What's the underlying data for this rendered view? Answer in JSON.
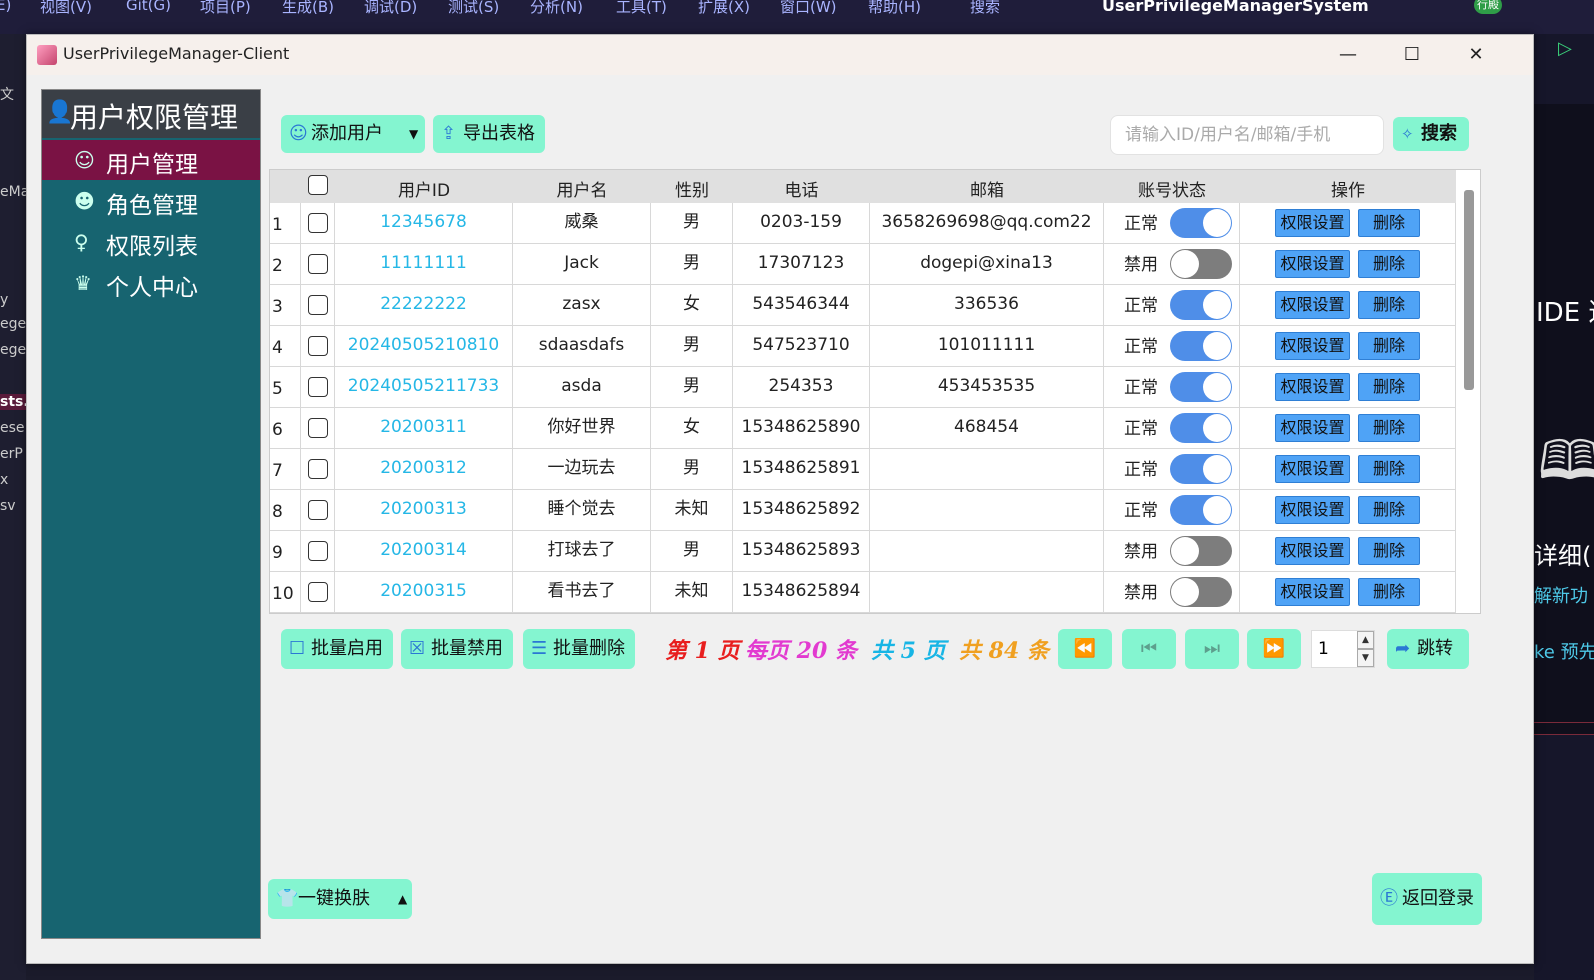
{
  "ide": {
    "menu": [
      "E)",
      "视图(V)",
      "Git(G)",
      "项目(P)",
      "生成(B)",
      "调试(D)",
      "测试(S)",
      "分析(N)",
      "工具(T)",
      "扩展(X)",
      "窗口(W)",
      "帮助(H)",
      "搜索"
    ],
    "solution_title": "UserPrivilegeManagerSystem",
    "right_badge": "行殿",
    "left_fragments": [
      "文",
      "eMa",
      "y",
      "ege",
      "ege",
      "sts.",
      "ese",
      "erP",
      "x",
      "sv"
    ],
    "right_fragments": {
      "ide": "IDE 这",
      "detail": "详细(",
      "newfn": "解新功",
      "preview": "ke 预先"
    }
  },
  "window": {
    "title": "UserPrivilegeManager-Client"
  },
  "sidebar": {
    "title": "用户权限管理",
    "items": [
      {
        "label": "用户管理",
        "icon": "user-icon",
        "active": true
      },
      {
        "label": "角色管理",
        "icon": "users-icon",
        "active": false
      },
      {
        "label": "权限列表",
        "icon": "user-key-icon",
        "active": false
      },
      {
        "label": "个人中心",
        "icon": "crown-icon",
        "active": false
      }
    ]
  },
  "toolbar": {
    "add_user": "添加用户",
    "export": "导出表格",
    "search_placeholder": "请输入ID/用户名/邮箱/手机",
    "search": "搜索"
  },
  "table": {
    "columns": [
      "用户ID",
      "用户名",
      "性别",
      "电话",
      "邮箱",
      "账号状态",
      "操作"
    ],
    "rows": [
      {
        "n": "1",
        "id": "12345678",
        "name": "威桑",
        "gender": "男",
        "phone": "0203-159",
        "email": "3658269698@qq.com22",
        "status": "正常",
        "enabled": true
      },
      {
        "n": "2",
        "id": "11111111",
        "name": "Jack",
        "gender": "男",
        "phone": "17307123",
        "email": "dogepi@xina13",
        "status": "禁用",
        "enabled": false
      },
      {
        "n": "3",
        "id": "22222222",
        "name": "zasx",
        "gender": "女",
        "phone": "543546344",
        "email": "336536",
        "status": "正常",
        "enabled": true
      },
      {
        "n": "4",
        "id": "20240505210810",
        "name": "sdaasdafs",
        "gender": "男",
        "phone": "547523710",
        "email": "101011111",
        "status": "正常",
        "enabled": true
      },
      {
        "n": "5",
        "id": "20240505211733",
        "name": "asda",
        "gender": "男",
        "phone": "254353",
        "email": "453453535",
        "status": "正常",
        "enabled": true
      },
      {
        "n": "6",
        "id": "20200311",
        "name": "你好世界",
        "gender": "女",
        "phone": "15348625890",
        "email": "468454",
        "status": "正常",
        "enabled": true
      },
      {
        "n": "7",
        "id": "20200312",
        "name": "一边玩去",
        "gender": "男",
        "phone": "15348625891",
        "email": "",
        "status": "正常",
        "enabled": true
      },
      {
        "n": "8",
        "id": "20200313",
        "name": "睡个觉去",
        "gender": "未知",
        "phone": "15348625892",
        "email": "",
        "status": "正常",
        "enabled": true
      },
      {
        "n": "9",
        "id": "20200314",
        "name": "打球去了",
        "gender": "男",
        "phone": "15348625893",
        "email": "",
        "status": "禁用",
        "enabled": false
      },
      {
        "n": "10",
        "id": "20200315",
        "name": "看书去了",
        "gender": "未知",
        "phone": "15348625894",
        "email": "",
        "status": "禁用",
        "enabled": false
      }
    ],
    "op_perm": "权限设置",
    "op_delete": "删除"
  },
  "batch": {
    "enable": "批量启用",
    "disable": "批量禁用",
    "delete": "批量删除"
  },
  "pager": {
    "page_text": "第 1 页",
    "per_page_text": "每页 20 条",
    "total_pages_text": "共 5 页",
    "total_items_text": "共 84 条",
    "page_input": "1",
    "jump": "跳转",
    "colors": {
      "page": "#e81e1e",
      "per_page": "#e23ad0",
      "total_pages": "#17b5e5",
      "total_items": "#f0a020"
    }
  },
  "footer": {
    "skin": "一键换肤",
    "back": "返回登录"
  }
}
